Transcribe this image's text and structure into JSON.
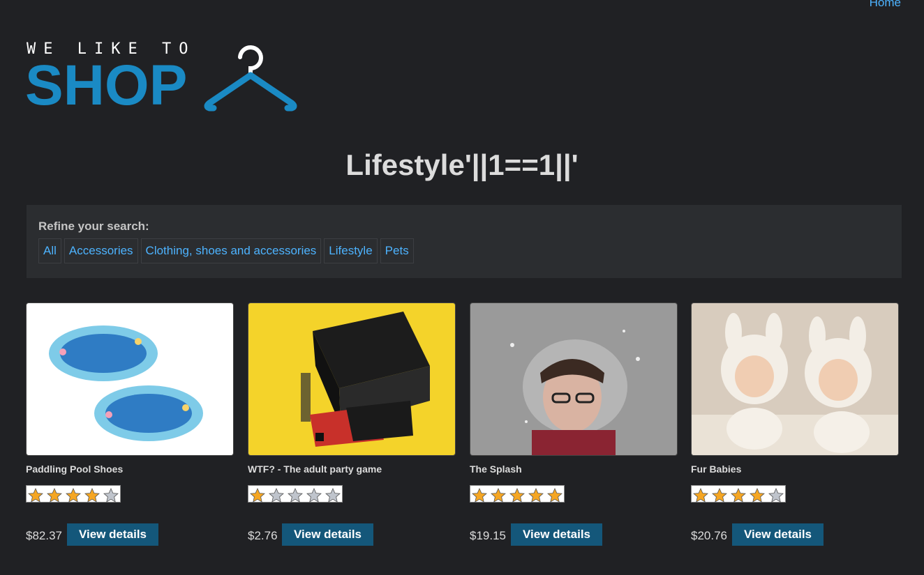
{
  "nav": {
    "home_label": "Home"
  },
  "logo": {
    "small_text": "WE LIKE TO",
    "big_text": "SHOP",
    "hanger_icon": "hanger-icon"
  },
  "page": {
    "title": "Lifestyle'||1==1||'"
  },
  "filter": {
    "label": "Refine your search:",
    "categories": [
      "All",
      "Accessories",
      "Clothing, shoes and accessories",
      "Lifestyle",
      "Pets"
    ]
  },
  "products": [
    {
      "name": "Paddling Pool Shoes",
      "rating": 4,
      "price": "$82.37",
      "button": "View details",
      "image": "paddling-pools"
    },
    {
      "name": "WTF? - The adult party game",
      "rating": 1,
      "price": "$2.76",
      "button": "View details",
      "image": "wtf-game-box"
    },
    {
      "name": "The Splash",
      "rating": 5,
      "price": "$19.15",
      "button": "View details",
      "image": "water-splash-face"
    },
    {
      "name": "Fur Babies",
      "rating": 4,
      "price": "$20.76",
      "button": "View details",
      "image": "babies-in-bunny-hats"
    }
  ],
  "colors": {
    "background": "#202124",
    "link": "#4db3ff",
    "logo": "#1a8ac4",
    "button": "#14577a",
    "star_full": "#f5a623",
    "star_empty": "#bfc4cc"
  }
}
